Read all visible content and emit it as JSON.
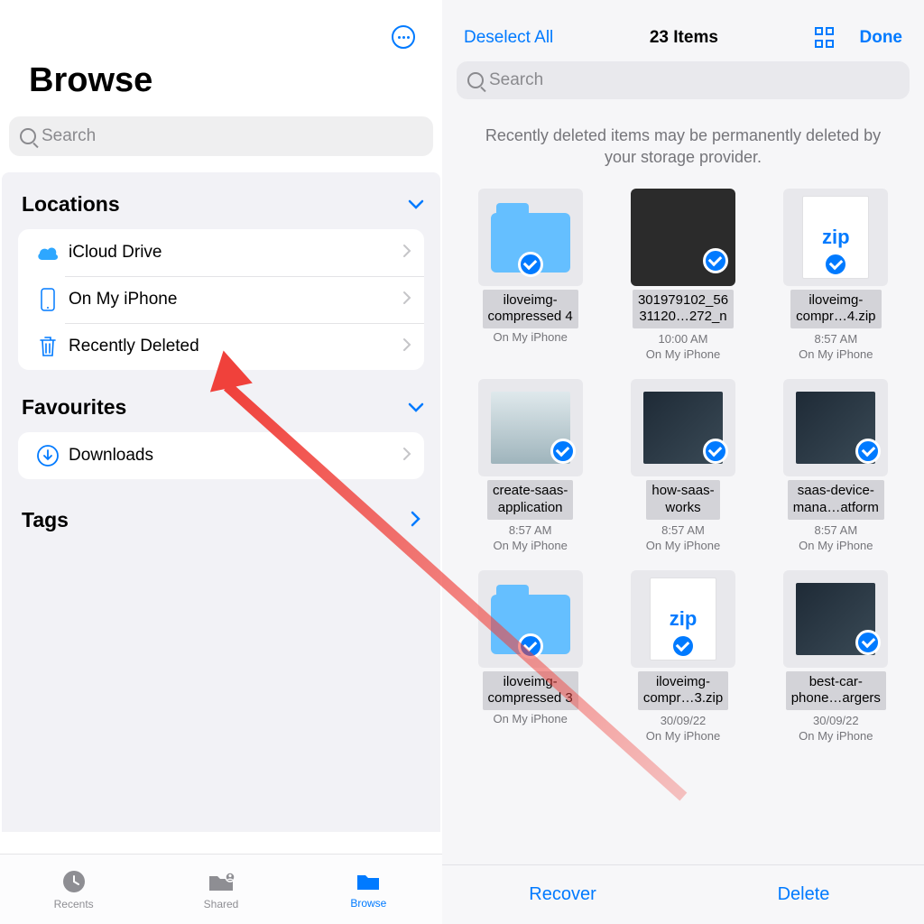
{
  "left": {
    "title": "Browse",
    "search_placeholder": "Search",
    "sections": {
      "locations": {
        "header": "Locations",
        "items": [
          {
            "icon": "icloud",
            "label": "iCloud Drive"
          },
          {
            "icon": "iphone",
            "label": "On My iPhone"
          },
          {
            "icon": "trash",
            "label": "Recently Deleted"
          }
        ]
      },
      "favourites": {
        "header": "Favourites",
        "items": [
          {
            "icon": "download",
            "label": "Downloads"
          }
        ]
      },
      "tags": {
        "header": "Tags"
      }
    },
    "tabs": [
      {
        "label": "Recents",
        "active": false
      },
      {
        "label": "Shared",
        "active": false
      },
      {
        "label": "Browse",
        "active": true
      }
    ]
  },
  "right": {
    "deselect": "Deselect All",
    "count": "23 Items",
    "done": "Done",
    "search_placeholder": "Search",
    "notice": "Recently deleted items may be permanently deleted by your storage provider.",
    "files": [
      {
        "type": "folder",
        "name_l1": "iloveimg-",
        "name_l2": "compressed 4",
        "time": "",
        "loc": "On My iPhone"
      },
      {
        "type": "img",
        "name_l1": "301979102_56",
        "name_l2": "31120…272_n",
        "time": "10:00 AM",
        "loc": "On My iPhone"
      },
      {
        "type": "zip",
        "name_l1": "iloveimg-",
        "name_l2": "compr…4.zip",
        "time": "8:57 AM",
        "loc": "On My iPhone"
      },
      {
        "type": "imgl",
        "name_l1": "create-saas-",
        "name_l2": "application",
        "time": "8:57 AM",
        "loc": "On My iPhone"
      },
      {
        "type": "imgd",
        "name_l1": "how-saas-",
        "name_l2": "works",
        "time": "8:57 AM",
        "loc": "On My iPhone"
      },
      {
        "type": "imgd",
        "name_l1": "saas-device-",
        "name_l2": "mana…atform",
        "time": "8:57 AM",
        "loc": "On My iPhone"
      },
      {
        "type": "folder",
        "name_l1": "iloveimg-",
        "name_l2": "compressed 3",
        "time": "",
        "loc": "On My iPhone"
      },
      {
        "type": "zip",
        "name_l1": "iloveimg-",
        "name_l2": "compr…3.zip",
        "time": "30/09/22",
        "loc": "On My iPhone"
      },
      {
        "type": "imgd",
        "name_l1": "best-car-",
        "name_l2": "phone…argers",
        "time": "30/09/22",
        "loc": "On My iPhone"
      }
    ],
    "bottom": {
      "recover": "Recover",
      "delete": "Delete"
    }
  }
}
